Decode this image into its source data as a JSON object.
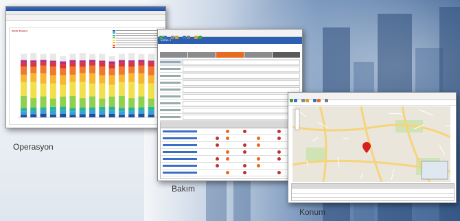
{
  "captions": {
    "operasyon": "Operasyon",
    "bakim": "Bakım",
    "konum": "Konum"
  },
  "window1": {
    "title": "",
    "chart_title": "Statü Bilgileri",
    "legend": [
      "",
      "",
      "",
      "",
      "",
      "",
      "",
      ""
    ],
    "bar_colors": [
      "#1f4e9c",
      "#3aa0d8",
      "#2bb3a0",
      "#8fd14f",
      "#f2e04b",
      "#f7b733",
      "#f07a2c",
      "#d9363e",
      "#b52f8a",
      "#e8e8e8"
    ]
  },
  "window2": {
    "tab_label": "Ekran 1",
    "tabs": [
      "",
      "",
      "",
      "",
      ""
    ],
    "section_labels": [
      "",
      "",
      "",
      ""
    ],
    "table_header": [
      "",
      "",
      "",
      "",
      "",
      ""
    ],
    "rows": [
      "",
      "",
      "",
      "",
      "",
      "",
      ""
    ],
    "accent": "#e86a1e"
  },
  "window3": {
    "map_title": "",
    "pin_color": "#d62020",
    "road_color": "#f6d47a"
  },
  "colors": {
    "blue_bar": "#2d5fb0",
    "orange": "#e86a1e"
  }
}
